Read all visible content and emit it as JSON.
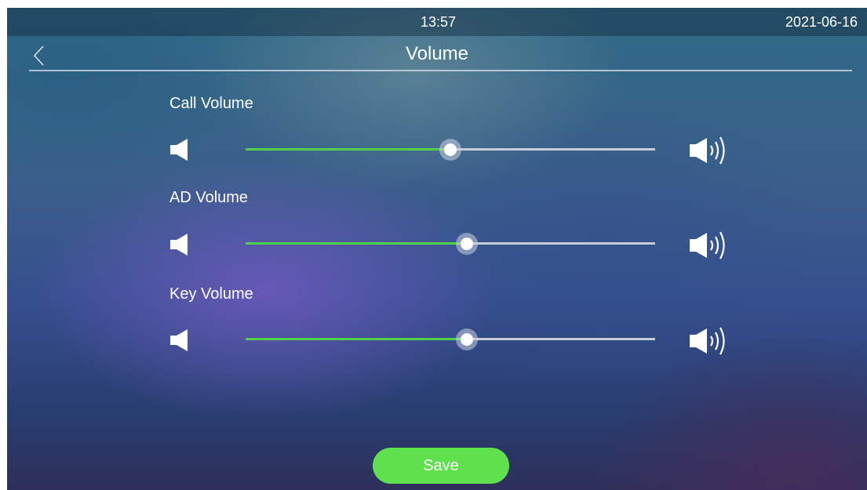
{
  "status_bar": {
    "time": "13:57",
    "date": "2021-06-16"
  },
  "header": {
    "back_icon": "chevron-left-icon",
    "title": "Volume"
  },
  "volumes": [
    {
      "label": "Call Volume",
      "level": 0.5
    },
    {
      "label": "AD Volume",
      "level": 0.54
    },
    {
      "label": "Key Volume",
      "level": 0.54
    }
  ],
  "icons": {
    "min": "speaker-low-icon",
    "max": "speaker-high-icon"
  },
  "save_button": {
    "label": "Save"
  },
  "colors": {
    "accent": "#4fd14a",
    "button": "#5fe04d",
    "track": "#c9cdd6"
  }
}
